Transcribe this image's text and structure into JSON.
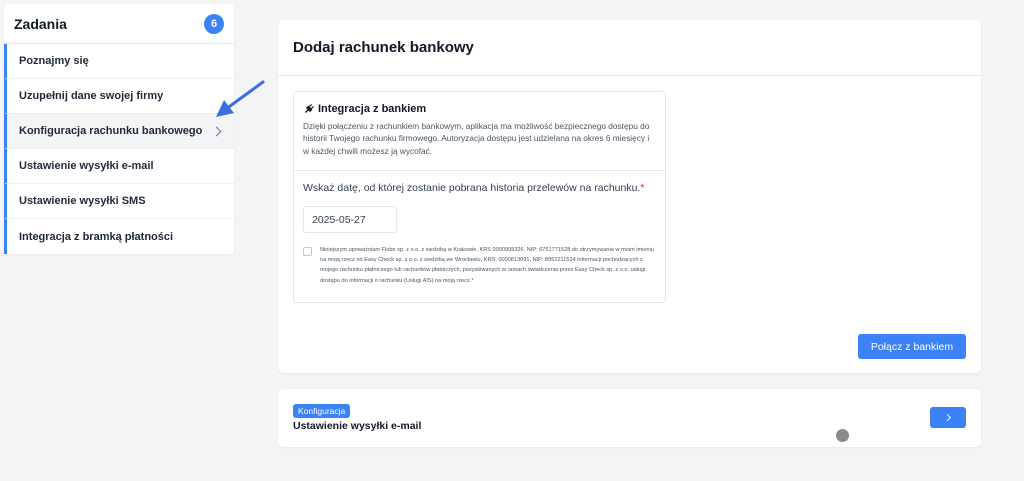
{
  "sidebar": {
    "title": "Zadania",
    "count": "6",
    "items": [
      {
        "label": "Poznajmy się"
      },
      {
        "label": "Uzupełnij dane swojej firmy"
      },
      {
        "label": "Konfiguracja rachunku bankowego"
      },
      {
        "label": "Ustawienie wysyłki e-mail"
      },
      {
        "label": "Ustawienie wysyłki SMS"
      },
      {
        "label": "Integracja z bramką płatności"
      }
    ]
  },
  "main": {
    "title": "Dodaj rachunek bankowy",
    "panel": {
      "heading": "Integracja z bankiem",
      "icon": "plug-icon",
      "description": "Dzięki połączeniu z rachunkiem bankowym, aplikacja ma możliwość bezpiecznego dostępu do historii Twojego rachunku firmowego. Autoryzacja dostępu jest udzielana na okres 6 miesięcy i w każdej chwili możesz ją wycofać.",
      "question": "Wskaż datę, od której zostanie pobrana historia przelewów na rachunku.",
      "required_mark": "*",
      "date_value": "2025-05-27",
      "consent_text": "Niniejszym upoważniam Flobo sp. z o.o. z siedzibą w Krakowie, KRS 0000995326, NIP: 6751771528 do otrzymywania w moim imieniu na moją rzecz od Easy Check sp. z o.o. z siedzibą we Wrocławiu, KRS: 0000813091, NIP: 8952211524 informacji pochodzących z mojego rachunku płatniczego lub rachunków płatniczych, pozyskiwanych w ramach świadczenia przez Easy Check sp. z o.o. usługi dostępu do informacji o rachunku (Usługi AIS) na moją rzecz.",
      "consent_required_mark": "*"
    },
    "connect_button": "Połącz z bankiem"
  },
  "next": {
    "badge": "Konfiguracja",
    "title": "Ustawienie wysyłki e-mail"
  },
  "colors": {
    "accent": "#3b82f6",
    "background": "#f3f4f6",
    "required": "#dc2626"
  }
}
